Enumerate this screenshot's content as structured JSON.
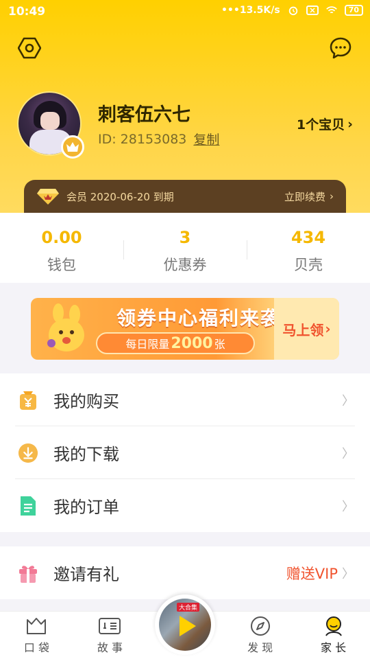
{
  "status_bar": {
    "time": "10:49",
    "speed": "13.5K/s",
    "battery": "70"
  },
  "profile": {
    "username": "刺客伍六七",
    "id_label": "ID: 28153083",
    "copy_label": "复制",
    "baby_label": "1个宝贝"
  },
  "vip": {
    "text": "会员 2020-06-20 到期",
    "renew_label": "立即续费"
  },
  "stats": [
    {
      "value": "0.00",
      "label": "钱包"
    },
    {
      "value": "3",
      "label": "优惠券"
    },
    {
      "value": "434",
      "label": "贝壳"
    }
  ],
  "banner": {
    "title": "领券中心福利来袭",
    "pill_prefix": "每日限量",
    "pill_number": "2000",
    "pill_suffix": "张",
    "cta": "马上领"
  },
  "menu": [
    {
      "label": "我的购买",
      "icon": "wallet-yen-icon"
    },
    {
      "label": "我的下载",
      "icon": "download-icon"
    },
    {
      "label": "我的订单",
      "icon": "order-doc-icon"
    }
  ],
  "invite": {
    "label": "邀请有礼",
    "right_label": "赠送VIP",
    "icon": "gift-icon"
  },
  "player": {
    "tag": "大合集"
  },
  "tabs": [
    {
      "label": "口 袋",
      "icon": "pocket-icon"
    },
    {
      "label": "故 事",
      "icon": "story-icon"
    },
    {
      "label": "",
      "icon": "player"
    },
    {
      "label": "发 现",
      "icon": "compass-icon"
    },
    {
      "label": "家 长",
      "icon": "parent-icon"
    }
  ],
  "colors": {
    "brand_yellow": "#ffd000",
    "accent_orange": "#f5b800",
    "vip_brown": "#5c4022",
    "red": "#f0532e"
  }
}
